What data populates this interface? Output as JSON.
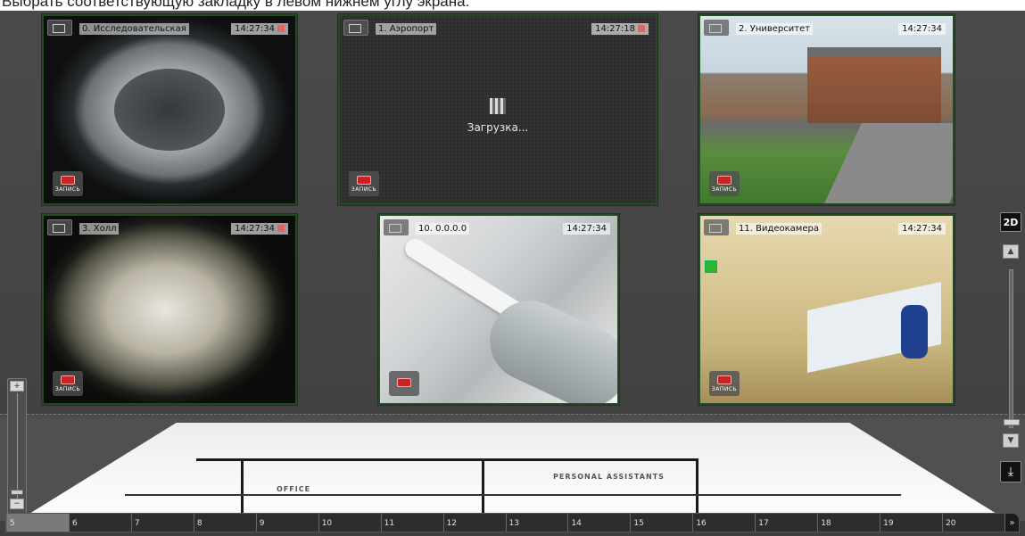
{
  "caption": "Выбрать соответствующую закладку в левом нижнем углу экрана.",
  "cameras": [
    {
      "name": "0. Исследовательская",
      "time": "14:27:34",
      "rec_label": "ЗАПИСЬ"
    },
    {
      "name": "1. Аэропорт",
      "time": "14:27:18",
      "rec_label": "ЗАПИСЬ",
      "loading": "Загрузка..."
    },
    {
      "name": "2. Университет",
      "time": "14:27:34",
      "rec_label": "ЗАПИСЬ"
    },
    {
      "name": "3. Холл",
      "time": "14:27:34",
      "rec_label": "ЗАПИСЬ"
    },
    {
      "name": "10. 0.0.0.0",
      "time": "14:27:34",
      "rec_label": ""
    },
    {
      "name": "11. Видеокамера",
      "time": "14:27:34",
      "rec_label": "ЗАПИСЬ"
    }
  ],
  "plan": {
    "labels": [
      "OFFICE",
      "PERSONAL ASSISTANTS"
    ]
  },
  "controls": {
    "view_2d": "2D",
    "scroll_up": "▲",
    "scroll_down": "▼",
    "zoom_in": "+",
    "zoom_out": "−",
    "layout": "⤓"
  },
  "timeline": {
    "cells": [
      "5",
      "6",
      "7",
      "8",
      "9",
      "10",
      "11",
      "12",
      "13",
      "14",
      "15",
      "16",
      "17",
      "18",
      "19",
      "20"
    ],
    "active_index": 0,
    "next": "»"
  },
  "colors": {
    "frame": "#1f4d1f",
    "background": "#3a3a3a",
    "record": "#cc2222"
  }
}
